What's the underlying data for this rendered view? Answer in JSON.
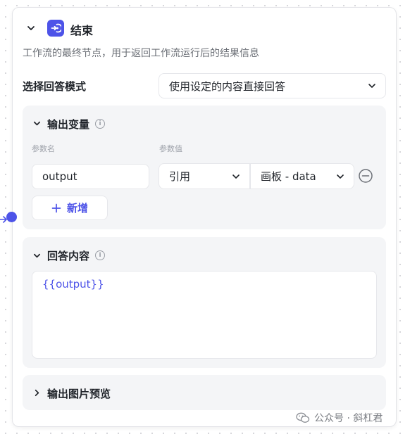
{
  "node": {
    "title": "结束",
    "description": "工作流的最终节点，用于返回工作流运行后的结果信息",
    "accent_color": "#4d53e8"
  },
  "answer_mode": {
    "label": "选择回答模式",
    "selected": "使用设定的内容直接回答"
  },
  "output_vars": {
    "title": "输出变量",
    "col_name": "参数名",
    "col_value": "参数值",
    "rows": [
      {
        "name": "output",
        "ref_type": "引用",
        "ref_value": "画板 - data"
      }
    ],
    "add_label": "新增"
  },
  "answer_content": {
    "title": "回答内容",
    "value": "{{output}}"
  },
  "image_preview": {
    "title": "输出图片预览"
  },
  "watermark": {
    "text": "公众号 · 斜杠君"
  }
}
